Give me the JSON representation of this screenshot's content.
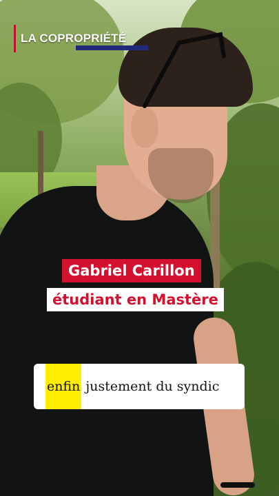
{
  "brand": {
    "label": "LA COPROPRIÉTÉ"
  },
  "speaker": {
    "name": "Gabriel Carillon",
    "role": "étudiant en Mastère"
  },
  "subtitle": {
    "highlight": "enfin",
    "rest": "justement du syndic"
  },
  "colors": {
    "accent_red": "#d4102f",
    "brand_navy": "#1f2a7a",
    "highlight_yellow": "#ffee00"
  }
}
